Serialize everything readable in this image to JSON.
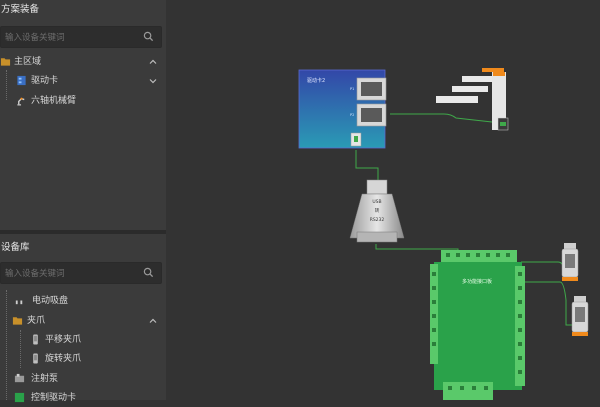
{
  "solution_panel": {
    "title": "方案装备",
    "search_placeholder": "输入设备关键词",
    "tree": [
      {
        "label": "主区域",
        "icon": "folder-icon"
      },
      {
        "label": "驱动卡",
        "icon": "drive-card-icon"
      },
      {
        "label": "六轴机械臂",
        "icon": "robot-arm-icon"
      }
    ]
  },
  "device_library": {
    "title": "设备库",
    "search_placeholder": "输入设备关键词",
    "tree": [
      {
        "label": "电动吸盘",
        "icon": "suction-cup-icon"
      },
      {
        "label": "夹爪",
        "icon": "folder-icon"
      },
      {
        "label": "平移夹爪",
        "icon": "gripper-icon"
      },
      {
        "label": "旋转夹爪",
        "icon": "gripper-icon"
      },
      {
        "label": "注射泵",
        "icon": "pump-icon"
      },
      {
        "label": "控制驱动卡",
        "icon": "drive-card-icon"
      }
    ]
  },
  "canvas": {
    "drive_card": {
      "label": "驱动卡2",
      "port1": "P1",
      "port2": "P2"
    },
    "usb_adapter": {
      "line1": "USB",
      "line2": "转",
      "line3": "RS232"
    },
    "io_board": {
      "label": "多功能接口板"
    }
  },
  "colors": {
    "folder": "#c8902a",
    "wire": "#3fa84a",
    "card_top": "#3347a8",
    "card_bottom": "#2a9bb5",
    "board": "#2aa24a",
    "accent_orange": "#f08a1c"
  }
}
